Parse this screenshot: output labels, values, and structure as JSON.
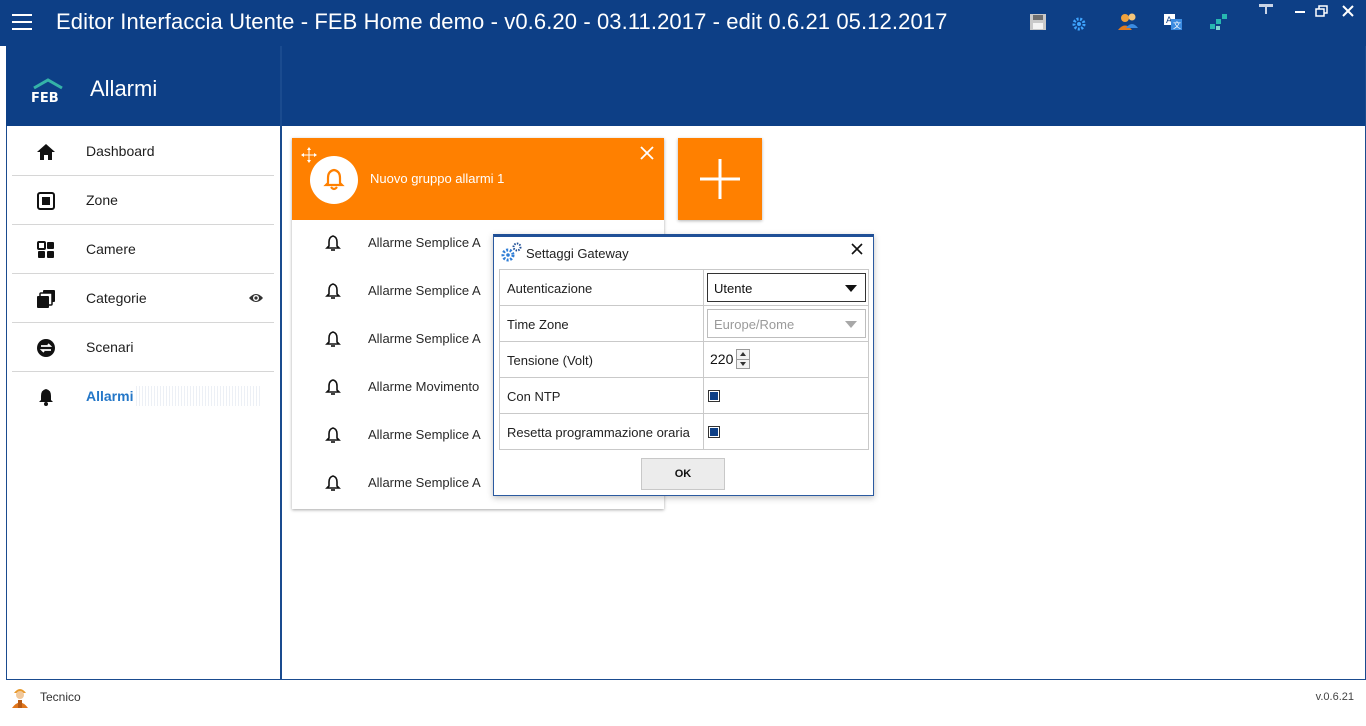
{
  "window": {
    "title": "Editor Interfaccia Utente - FEB Home demo - v0.6.20 - 03.11.2017 - edit 0.6.21 05.12.2017"
  },
  "toolbar": {
    "icons": [
      "save-icon",
      "settings-gear-icon",
      "users-icon",
      "translate-icon",
      "network-icon"
    ]
  },
  "colors": {
    "brand_blue": "#0d3f86",
    "accent_orange": "#ff8000",
    "active_link": "#2477c8"
  },
  "sidebar": {
    "logo_text": "FEB",
    "section_title": "Allarmi",
    "items": [
      {
        "label": "Dashboard",
        "icon": "home-icon",
        "active": false
      },
      {
        "label": "Zone",
        "icon": "zone-square-icon",
        "active": false
      },
      {
        "label": "Camere",
        "icon": "grid-icon",
        "active": false
      },
      {
        "label": "Categorie",
        "icon": "layers-icon",
        "active": false,
        "visible_icon": "eye-icon"
      },
      {
        "label": "Scenari",
        "icon": "swap-icon",
        "active": false
      },
      {
        "label": "Allarmi",
        "icon": "bell-icon",
        "active": true
      }
    ]
  },
  "alarm_group": {
    "name": "Nuovo gruppo allarmi 1",
    "items": [
      {
        "label": "Allarme Semplice  A"
      },
      {
        "label": "Allarme Semplice  A"
      },
      {
        "label": "Allarme Semplice  A"
      },
      {
        "label": "Allarme Movimento"
      },
      {
        "label": "Allarme Semplice  A"
      },
      {
        "label": "Allarme Semplice  A"
      }
    ]
  },
  "dialog": {
    "title": "Settaggi Gateway",
    "rows": {
      "auth_label": "Autenticazione",
      "auth_value": "Utente",
      "tz_label": "Time Zone",
      "tz_value": "Europe/Rome",
      "voltage_label": "Tensione (Volt)",
      "voltage_value": "220",
      "ntp_label": "Con NTP",
      "ntp_checked": true,
      "reset_label": "Resetta programmazione oraria",
      "reset_checked": true
    },
    "ok_label": "OK"
  },
  "status": {
    "user": "Tecnico",
    "version": "v.0.6.21"
  }
}
